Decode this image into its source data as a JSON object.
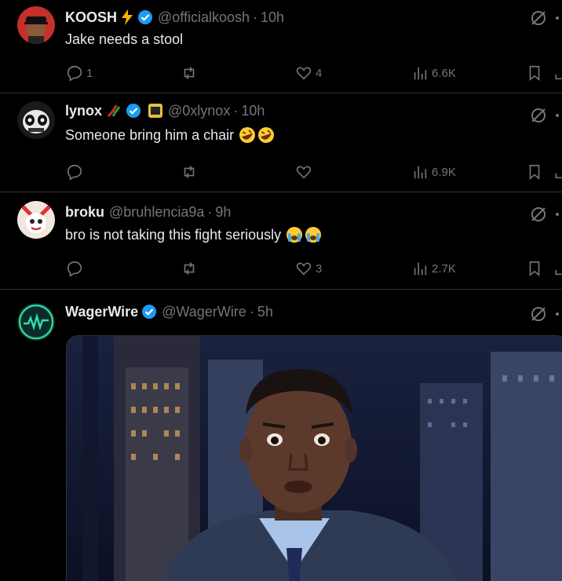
{
  "posts": [
    {
      "display_name": "KOOSH",
      "handle": "@officialkoosh",
      "time": "10h",
      "text": "Jake needs a stool",
      "replies": "1",
      "likes": "4",
      "views": "6.6K",
      "name_emoji": "lightning-emoji",
      "verified": true
    },
    {
      "display_name": "lynox",
      "handle": "@0xlynox",
      "time": "10h",
      "text": "Someone bring him a chair",
      "text_emoji": [
        "rofl-emoji",
        "rofl-emoji"
      ],
      "replies": "",
      "likes": "",
      "views": "6.9K",
      "name_emoji": "chili-pepper-emoji",
      "verified": true
    },
    {
      "display_name": "broku",
      "handle": "@bruhlencia9a",
      "time": "9h",
      "text": "bro is not taking this fight seriously",
      "text_emoji": [
        "crying-emoji",
        "crying-emoji"
      ],
      "replies": "",
      "likes": "3",
      "views": "2.7K",
      "verified": false
    },
    {
      "display_name": "WagerWire",
      "handle": "@WagerWire",
      "time": "5h",
      "verified": true,
      "media": "gif-still-man-surprised"
    }
  ],
  "separator": "·",
  "colors": {
    "background": "#000000",
    "text": "#e7e9ea",
    "muted": "#71767b",
    "verified": "#1d9bf0",
    "border": "#2f3336"
  }
}
